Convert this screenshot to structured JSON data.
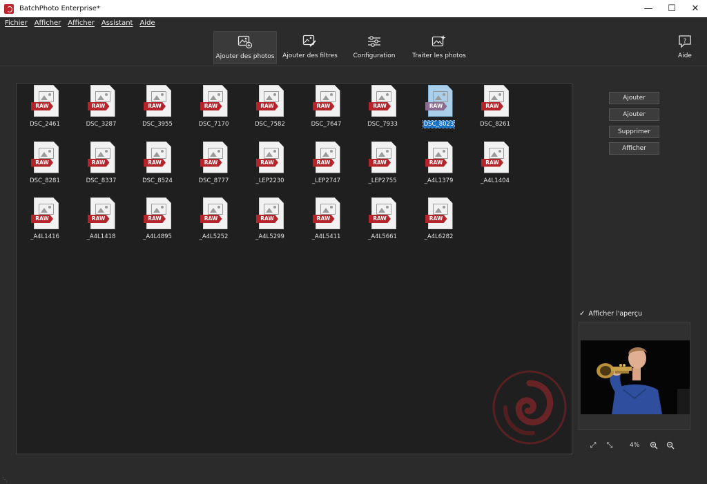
{
  "window": {
    "title": "BatchPhoto Enterprise*"
  },
  "menu": [
    "Fichier",
    "Afficher",
    "Afficher",
    "Assistant",
    "Aide"
  ],
  "toolbar": {
    "add_photos": "Ajouter des photos",
    "add_filters": "Ajouter des filtres",
    "configuration": "Configuration",
    "process": "Traiter les photos",
    "help": "Aide"
  },
  "files": [
    {
      "name": "DSC_2461",
      "tag": "RAW"
    },
    {
      "name": "DSC_3287",
      "tag": "RAW"
    },
    {
      "name": "DSC_3955",
      "tag": "RAW"
    },
    {
      "name": "DSC_7170",
      "tag": "RAW"
    },
    {
      "name": "DSC_7582",
      "tag": "RAW"
    },
    {
      "name": "DSC_7647",
      "tag": "RAW"
    },
    {
      "name": "DSC_7933",
      "tag": "RAW"
    },
    {
      "name": "DSC_8023",
      "tag": "RAW",
      "selected": true
    },
    {
      "name": "DSC_8261",
      "tag": "RAW"
    },
    {
      "name": "DSC_8281",
      "tag": "RAW"
    },
    {
      "name": "DSC_8337",
      "tag": "RAW"
    },
    {
      "name": "DSC_8524",
      "tag": "RAW"
    },
    {
      "name": "DSC_8777",
      "tag": "RAW"
    },
    {
      "name": "_LEP2230",
      "tag": "RAW"
    },
    {
      "name": "_LEP2747",
      "tag": "RAW"
    },
    {
      "name": "_LEP2755",
      "tag": "RAW"
    },
    {
      "name": "_A4L1379",
      "tag": "RAW"
    },
    {
      "name": "_A4L1404",
      "tag": "RAW"
    },
    {
      "name": "_A4L1416",
      "tag": "RAW"
    },
    {
      "name": "_A4L1418",
      "tag": "RAW"
    },
    {
      "name": "_A4L4895",
      "tag": "RAW"
    },
    {
      "name": "_A4L5252",
      "tag": "RAW"
    },
    {
      "name": "_A4L5299",
      "tag": "RAW"
    },
    {
      "name": "_A4L5411",
      "tag": "RAW"
    },
    {
      "name": "_A4L5661",
      "tag": "RAW"
    },
    {
      "name": "_A4L6282",
      "tag": "RAW"
    }
  ],
  "side_buttons": [
    "Ajouter",
    "Ajouter",
    "Supprimer",
    "Afficher"
  ],
  "preview": {
    "checkbox_label": "Afficher l'aperçu",
    "checked": true,
    "zoom": "4%"
  },
  "colors": {
    "accent": "#1a73c4",
    "raw_tag": "#b3252b",
    "background": "#2b2b2b"
  }
}
